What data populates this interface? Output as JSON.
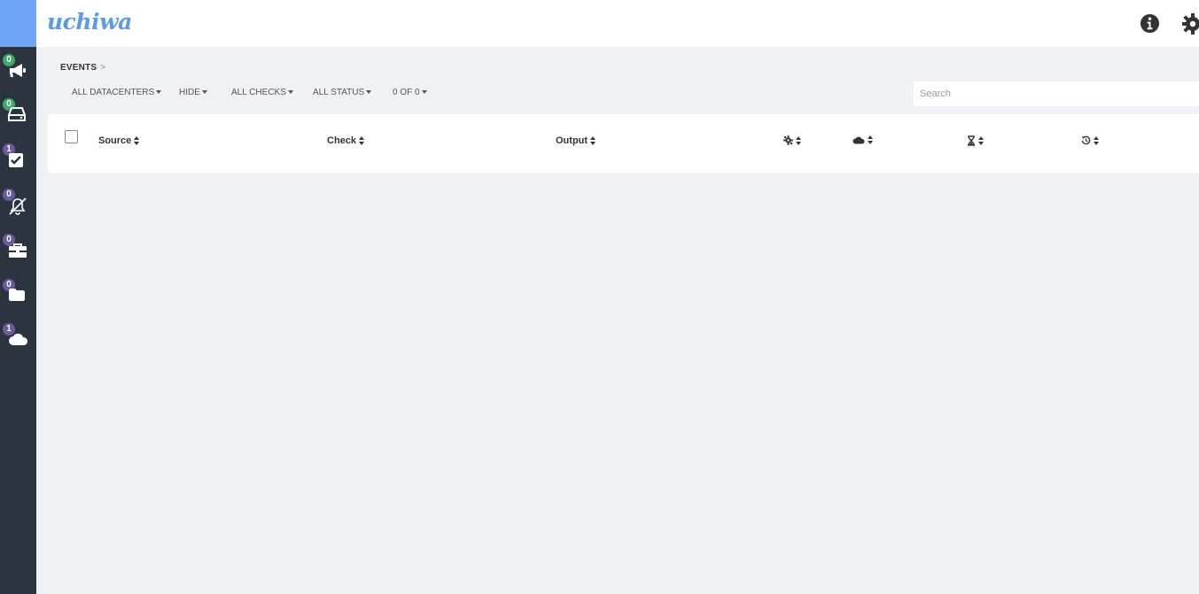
{
  "app": {
    "brand": "uchiwa"
  },
  "sidebar": {
    "items": [
      {
        "name": "events",
        "badge": "0",
        "badge_color": "#3dac63",
        "icon": "megaphone-icon"
      },
      {
        "name": "clients",
        "badge": "0",
        "badge_color": "#3dac63",
        "icon": "hdd-icon"
      },
      {
        "name": "checks",
        "badge": "1",
        "badge_color": "#6b5a9f",
        "icon": "check-square-icon"
      },
      {
        "name": "silenced",
        "badge": "0",
        "badge_color": "#6b5a9f",
        "icon": "bell-slash-icon"
      },
      {
        "name": "stashes",
        "badge": "0",
        "badge_color": "#6b5a9f",
        "icon": "toolbox-icon"
      },
      {
        "name": "aggregates",
        "badge": "0",
        "badge_color": "#6b5a9f",
        "icon": "folder-icon"
      },
      {
        "name": "datacenters",
        "badge": "1",
        "badge_color": "#6b5a9f",
        "icon": "cloud-icon"
      }
    ]
  },
  "breadcrumb": {
    "label": "EVENTS",
    "separator": ">"
  },
  "filters": {
    "datacenters": "ALL DATACENTERS",
    "hide": "HIDE",
    "checks": "ALL CHECKS",
    "status": "ALL STATUS",
    "pagination": "0 OF 0"
  },
  "search": {
    "placeholder": "Search",
    "value": ""
  },
  "table": {
    "columns": {
      "source": "Source",
      "check": "Check",
      "output": "Output"
    },
    "icon_columns": [
      "status-icon",
      "datacenter-icon",
      "occurrences-icon",
      "timestamp-icon"
    ]
  },
  "colors": {
    "sidebar": "#2c3440",
    "accent": "#6ea5f5",
    "brand": "#5a9ae6",
    "badge_green": "#3dac63",
    "badge_purple": "#6b5a9f"
  }
}
